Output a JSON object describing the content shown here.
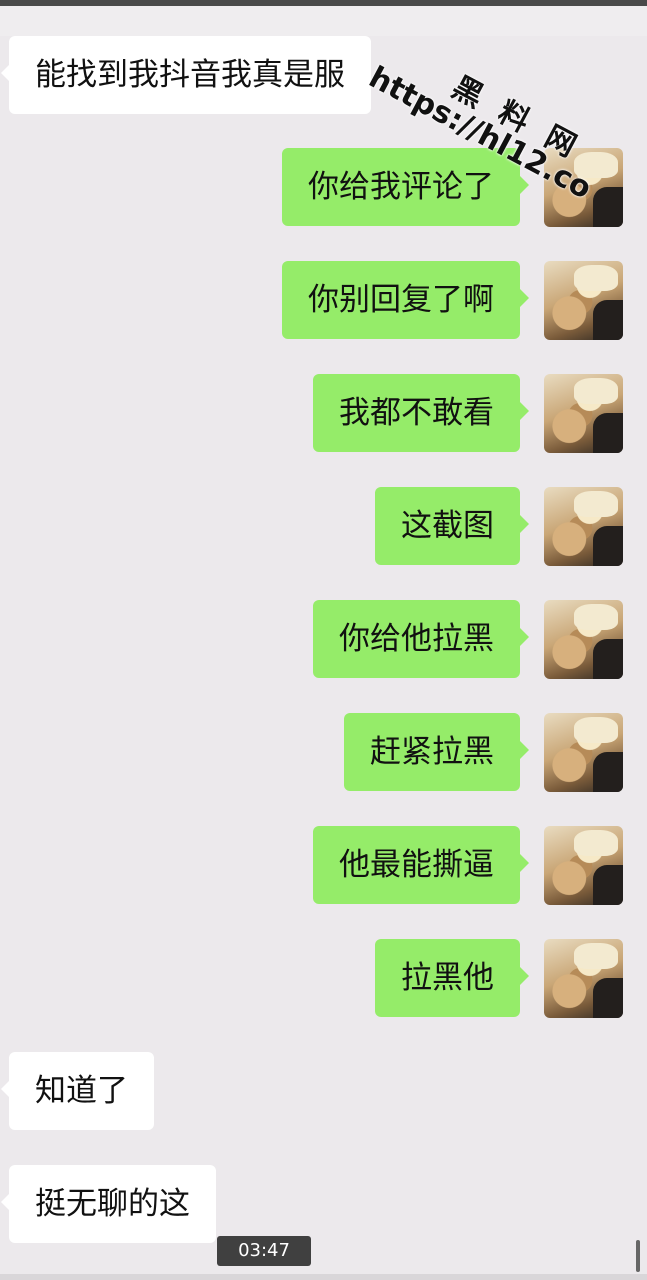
{
  "watermark": {
    "brand": "黑 料 网",
    "url": "https://hl12.co"
  },
  "messages": [
    {
      "side": "in",
      "text": "能找到我抖音我真是服"
    },
    {
      "side": "out",
      "text": "你给我评论了"
    },
    {
      "side": "out",
      "text": "你别回复了啊"
    },
    {
      "side": "out",
      "text": "我都不敢看"
    },
    {
      "side": "out",
      "text": "这截图"
    },
    {
      "side": "out",
      "text": "你给他拉黑"
    },
    {
      "side": "out",
      "text": "赶紧拉黑"
    },
    {
      "side": "out",
      "text": "他最能撕逼"
    },
    {
      "side": "out",
      "text": "拉黑他"
    },
    {
      "side": "in",
      "text": "知道了"
    },
    {
      "side": "in",
      "text": "挺无聊的这"
    }
  ],
  "video": {
    "timestamp": "03:47"
  },
  "colors": {
    "background": "#ece9ec",
    "incoming_bubble": "#ffffff",
    "outgoing_bubble": "#95ec69"
  },
  "icons": {
    "avatar": "user-avatar-photo"
  }
}
